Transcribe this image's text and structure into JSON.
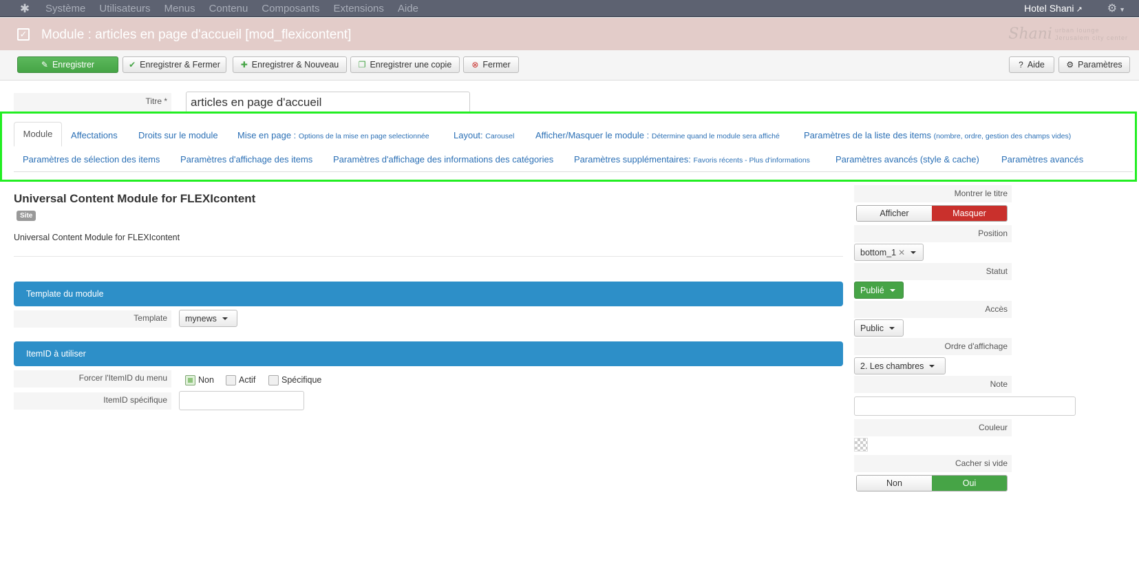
{
  "topnav": {
    "items": [
      "Système",
      "Utilisateurs",
      "Menus",
      "Contenu",
      "Composants",
      "Extensions",
      "Aide"
    ],
    "site_name": "Hotel Shani"
  },
  "titlebar": {
    "title": "Module : articles en page d'accueil [mod_flexicontent]",
    "brand_script": "Shani",
    "brand_line1": "urban lounge",
    "brand_line2": "Jerusalem city center"
  },
  "toolbar": {
    "save": "Enregistrer",
    "save_close": "Enregistrer & Fermer",
    "save_new": "Enregistrer & Nouveau",
    "save_copy": "Enregistrer une copie",
    "close": "Fermer",
    "help": "Aide",
    "options": "Paramètres"
  },
  "form": {
    "titre_label": "Titre *",
    "titre_value": "articles en page d'accueil"
  },
  "tabs": {
    "module": "Module",
    "affectations": "Affectations",
    "droits": "Droits sur le module",
    "mise_en_page": "Mise en page :",
    "mise_en_page_sub": "Options de la mise en page selectionnée",
    "layout": "Layout:",
    "layout_sub": "Carousel",
    "afficher": "Afficher/Masquer le module :",
    "afficher_sub": "Détermine quand le module sera affiché",
    "liste": "Paramètres de la liste des items",
    "liste_sub": "(nombre, ordre, gestion des champs vides)",
    "selection": "Paramètres de sélection des items",
    "affichage_items": "Paramètres d'affichage des items",
    "affichage_cat": "Paramètres d'affichage des informations des catégories",
    "supp": "Paramètres supplémentaires:",
    "supp_sub": "Favoris récents - Plus d'informations",
    "avances_style": "Paramètres avancés (style & cache)",
    "avances": "Paramètres avancés"
  },
  "main": {
    "heading": "Universal Content Module for FLEXIcontent",
    "badge": "Site",
    "description": "Universal Content Module for FLEXIcontent",
    "panel_template": "Template du module",
    "template_label": "Template",
    "template_value": "mynews",
    "panel_itemid": "ItemID à utiliser",
    "force_label": "Forcer l'ItemID du menu",
    "opt_non": "Non",
    "opt_actif": "Actif",
    "opt_specifique": "Spécifique",
    "itemid_label": "ItemID spécifique"
  },
  "side": {
    "show_title_label": "Montrer le titre",
    "show": "Afficher",
    "hide": "Masquer",
    "position_label": "Position",
    "position_value": "bottom_1",
    "status_label": "Statut",
    "status_value": "Publié",
    "access_label": "Accès",
    "access_value": "Public",
    "order_label": "Ordre d'affichage",
    "order_value": "2. Les chambres",
    "note_label": "Note",
    "color_label": "Couleur",
    "hide_empty_label": "Cacher si vide",
    "non": "Non",
    "oui": "Oui"
  },
  "colors": {
    "topnav": "#5d6271",
    "titlebar": "#e3ccc9",
    "save": "#46a446",
    "panel": "#2d8fc8",
    "danger": "#c9302c",
    "highlight": "#22ee22"
  }
}
